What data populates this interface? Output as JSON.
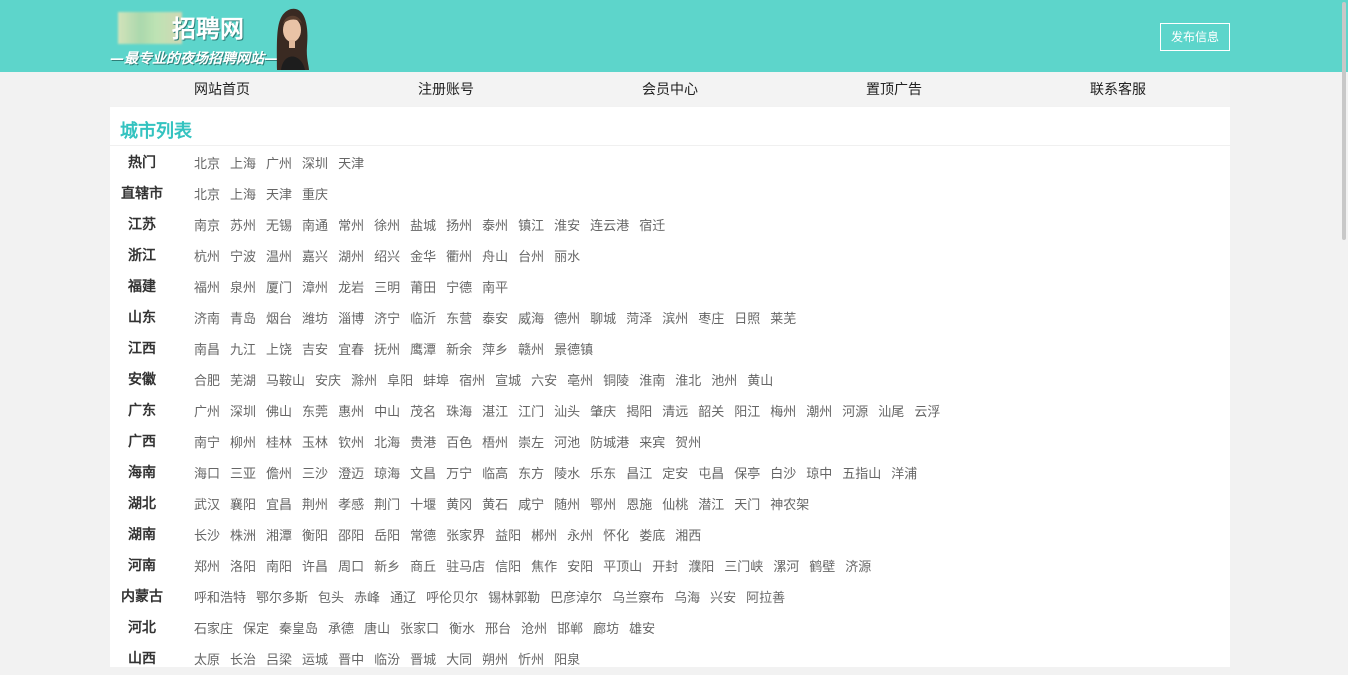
{
  "header": {
    "logo_title": "招聘网",
    "logo_slogan": "—最专业的夜场招聘网站—",
    "publish_label": "发布信息",
    "bg_color": "#5dd5cb"
  },
  "nav": {
    "items": [
      "网站首页",
      "注册账号",
      "会员中心",
      "置顶广告",
      "联系客服"
    ]
  },
  "main": {
    "section_title": "城市列表",
    "accent_color": "#34c3c0",
    "rows": [
      {
        "label": "热门",
        "cities": [
          "北京",
          "上海",
          "广州",
          "深圳",
          "天津"
        ]
      },
      {
        "label": "直辖市",
        "cities": [
          "北京",
          "上海",
          "天津",
          "重庆"
        ]
      },
      {
        "label": "江苏",
        "cities": [
          "南京",
          "苏州",
          "无锡",
          "南通",
          "常州",
          "徐州",
          "盐城",
          "扬州",
          "泰州",
          "镇江",
          "淮安",
          "连云港",
          "宿迁"
        ]
      },
      {
        "label": "浙江",
        "cities": [
          "杭州",
          "宁波",
          "温州",
          "嘉兴",
          "湖州",
          "绍兴",
          "金华",
          "衢州",
          "舟山",
          "台州",
          "丽水"
        ]
      },
      {
        "label": "福建",
        "cities": [
          "福州",
          "泉州",
          "厦门",
          "漳州",
          "龙岩",
          "三明",
          "莆田",
          "宁德",
          "南平"
        ]
      },
      {
        "label": "山东",
        "cities": [
          "济南",
          "青岛",
          "烟台",
          "潍坊",
          "淄博",
          "济宁",
          "临沂",
          "东营",
          "泰安",
          "威海",
          "德州",
          "聊城",
          "菏泽",
          "滨州",
          "枣庄",
          "日照",
          "莱芜"
        ]
      },
      {
        "label": "江西",
        "cities": [
          "南昌",
          "九江",
          "上饶",
          "吉安",
          "宜春",
          "抚州",
          "鹰潭",
          "新余",
          "萍乡",
          "赣州",
          "景德镇"
        ]
      },
      {
        "label": "安徽",
        "cities": [
          "合肥",
          "芜湖",
          "马鞍山",
          "安庆",
          "滁州",
          "阜阳",
          "蚌埠",
          "宿州",
          "宣城",
          "六安",
          "亳州",
          "铜陵",
          "淮南",
          "淮北",
          "池州",
          "黄山"
        ]
      },
      {
        "label": "广东",
        "cities": [
          "广州",
          "深圳",
          "佛山",
          "东莞",
          "惠州",
          "中山",
          "茂名",
          "珠海",
          "湛江",
          "江门",
          "汕头",
          "肇庆",
          "揭阳",
          "清远",
          "韶关",
          "阳江",
          "梅州",
          "潮州",
          "河源",
          "汕尾",
          "云浮"
        ]
      },
      {
        "label": "广西",
        "cities": [
          "南宁",
          "柳州",
          "桂林",
          "玉林",
          "钦州",
          "北海",
          "贵港",
          "百色",
          "梧州",
          "崇左",
          "河池",
          "防城港",
          "来宾",
          "贺州"
        ]
      },
      {
        "label": "海南",
        "cities": [
          "海口",
          "三亚",
          "儋州",
          "三沙",
          "澄迈",
          "琼海",
          "文昌",
          "万宁",
          "临高",
          "东方",
          "陵水",
          "乐东",
          "昌江",
          "定安",
          "屯昌",
          "保亭",
          "白沙",
          "琼中",
          "五指山",
          "洋浦"
        ]
      },
      {
        "label": "湖北",
        "cities": [
          "武汉",
          "襄阳",
          "宜昌",
          "荆州",
          "孝感",
          "荆门",
          "十堰",
          "黄冈",
          "黄石",
          "咸宁",
          "随州",
          "鄂州",
          "恩施",
          "仙桃",
          "潜江",
          "天门",
          "神农架"
        ]
      },
      {
        "label": "湖南",
        "cities": [
          "长沙",
          "株洲",
          "湘潭",
          "衡阳",
          "邵阳",
          "岳阳",
          "常德",
          "张家界",
          "益阳",
          "郴州",
          "永州",
          "怀化",
          "娄底",
          "湘西"
        ]
      },
      {
        "label": "河南",
        "cities": [
          "郑州",
          "洛阳",
          "南阳",
          "许昌",
          "周口",
          "新乡",
          "商丘",
          "驻马店",
          "信阳",
          "焦作",
          "安阳",
          "平顶山",
          "开封",
          "濮阳",
          "三门峡",
          "漯河",
          "鹤壁",
          "济源"
        ]
      },
      {
        "label": "内蒙古",
        "cities": [
          "呼和浩特",
          "鄂尔多斯",
          "包头",
          "赤峰",
          "通辽",
          "呼伦贝尔",
          "锡林郭勒",
          "巴彦淖尔",
          "乌兰察布",
          "乌海",
          "兴安",
          "阿拉善"
        ]
      },
      {
        "label": "河北",
        "cities": [
          "石家庄",
          "保定",
          "秦皇岛",
          "承德",
          "唐山",
          "张家口",
          "衡水",
          "邢台",
          "沧州",
          "邯郸",
          "廊坊",
          "雄安"
        ]
      },
      {
        "label": "山西",
        "cities": [
          "太原",
          "长治",
          "吕梁",
          "运城",
          "晋中",
          "临汾",
          "晋城",
          "大同",
          "朔州",
          "忻州",
          "阳泉"
        ]
      }
    ]
  }
}
